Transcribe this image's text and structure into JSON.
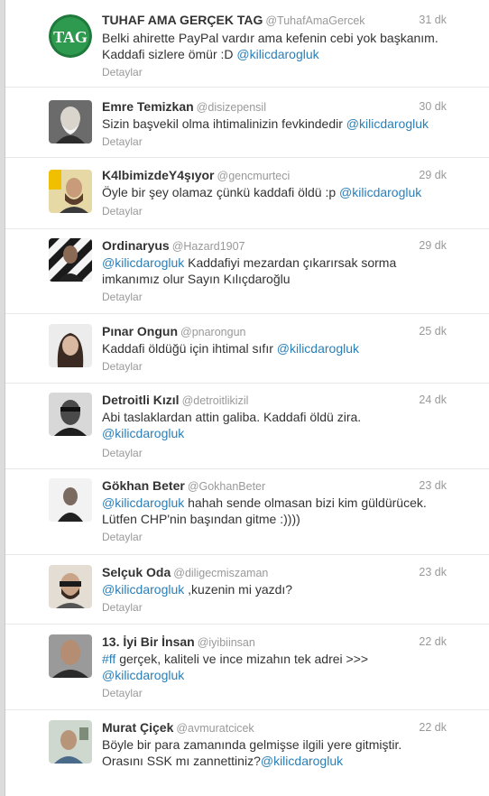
{
  "tweets": [
    {
      "fullname": "TUHAF AMA GERÇEK TAG",
      "username": "@TuhafAmaGercek",
      "time": "31 dk",
      "text": [
        [
          {
            "t": "Belki ahirette PayPal vardır ama kefenin cebi yok başkanım."
          }
        ],
        [
          {
            "t": "Kaddafi sizlere ömür :D "
          },
          {
            "t": "@kilicdarogluk",
            "m": 1
          }
        ]
      ],
      "details": "Detaylar",
      "avatar_text": "TAG"
    },
    {
      "fullname": "Emre Temizkan",
      "username": "@disizepensil",
      "time": "30 dk",
      "text": [
        [
          {
            "t": "Sizin başvekil olma ihtimalinizin fevkindedir "
          },
          {
            "t": "@kilicdarogluk",
            "m": 1
          }
        ]
      ],
      "details": "Detaylar"
    },
    {
      "fullname": "K4lbimizdeY4şıyor",
      "username": "@gencmurteci",
      "time": "29 dk",
      "text": [
        [
          {
            "t": "Öyle bir şey olamaz çünkü kaddafi öldü :p "
          },
          {
            "t": "@kilicdarogluk",
            "m": 1
          }
        ]
      ],
      "details": "Detaylar"
    },
    {
      "fullname": "Ordinaryus",
      "username": "@Hazard1907",
      "time": "29 dk",
      "text": [
        [
          {
            "t": "@kilicdarogluk",
            "m": 1
          },
          {
            "t": " Kaddafiyi mezardan çıkarırsak sorma"
          }
        ],
        [
          {
            "t": "imkanımız olur Sayın Kılıçdaroğlu"
          }
        ]
      ],
      "details": "Detaylar"
    },
    {
      "fullname": "Pınar Ongun",
      "username": "@pnarongun",
      "time": "25 dk",
      "text": [
        [
          {
            "t": "Kaddafi öldüğü için ihtimal sıfır "
          },
          {
            "t": "@kilicdarogluk",
            "m": 1
          }
        ]
      ],
      "details": "Detaylar"
    },
    {
      "fullname": "Detroitli Kızıl",
      "username": "@detroitlikizil",
      "time": "24 dk",
      "text": [
        [
          {
            "t": "Abi taslaklardan attin galiba.  Kaddafi öldü zira."
          }
        ],
        [
          {
            "t": "@kilicdarogluk",
            "m": 1
          }
        ]
      ],
      "details": "Detaylar"
    },
    {
      "fullname": "Gökhan Beter",
      "username": "@GokhanBeter",
      "time": "23 dk",
      "text": [
        [
          {
            "t": "@kilicdarogluk",
            "m": 1
          },
          {
            "t": " hahah sende olmasan bizi kim güldürücek."
          }
        ],
        [
          {
            "t": "Lütfen CHP'nin başından gitme :))))"
          }
        ]
      ],
      "details": "Detaylar"
    },
    {
      "fullname": "Selçuk Oda",
      "username": "@diligecmiszaman",
      "time": "23 dk",
      "text": [
        [
          {
            "t": "@kilicdarogluk",
            "m": 1
          },
          {
            "t": " ,kuzenin mi yazdı?"
          }
        ]
      ],
      "details": "Detaylar"
    },
    {
      "fullname": "13. İyi Bir İnsan",
      "username": "@iyibiinsan",
      "time": "22 dk",
      "text": [
        [
          {
            "t": "#ff",
            "h": 1
          },
          {
            "t": " gerçek, kaliteli ve ince mizahın tek adrei  >>>"
          }
        ],
        [
          {
            "t": "@kilicdarogluk",
            "m": 1
          }
        ]
      ],
      "details": "Detaylar"
    },
    {
      "fullname": "Murat Çiçek",
      "username": "@avmuratcicek",
      "time": "22 dk",
      "text": [
        [
          {
            "t": "Böyle bir para zamanında gelmişse ilgili yere gitmiştir."
          }
        ],
        [
          {
            "t": "Orasını SSK mı zannettiniz?"
          },
          {
            "t": "@kilicdarogluk",
            "m": 1
          }
        ]
      ],
      "details": "Detaylar"
    }
  ]
}
